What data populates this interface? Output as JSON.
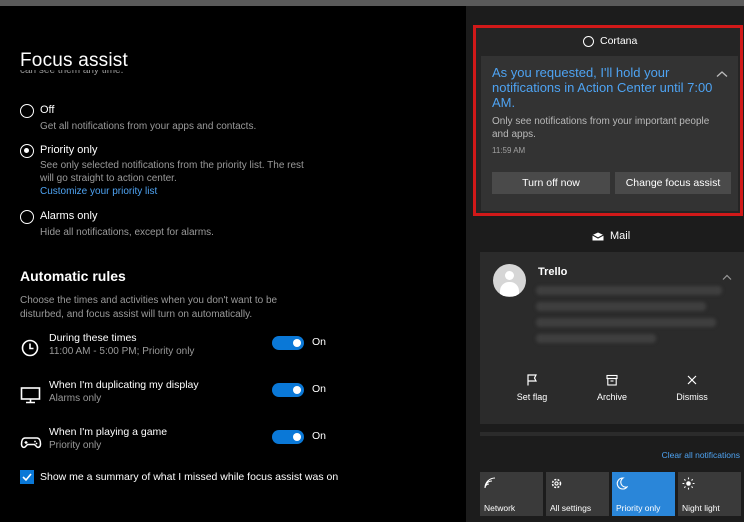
{
  "settings": {
    "title": "Focus assist",
    "clipped_text": "can see them any time.",
    "options": [
      {
        "label": "Off",
        "desc": "Get all notifications from your apps and contacts.",
        "checked": false
      },
      {
        "label": "Priority only",
        "desc_line1": "See only selected notifications from the priority list. The rest",
        "desc_line2": "will go straight to action center.",
        "link": "Customize your priority list",
        "checked": true
      },
      {
        "label": "Alarms only",
        "desc": "Hide all notifications, except for alarms.",
        "checked": false
      }
    ],
    "automatic_rules": {
      "title": "Automatic rules",
      "desc": "Choose the times and activities when you don't want to be disturbed, and focus assist will turn on automatically.",
      "rules": [
        {
          "title": "During these times",
          "subtitle": "11:00 AM - 5:00 PM; Priority only",
          "state": "On",
          "icon": "clock-icon"
        },
        {
          "title": "When I'm duplicating my display",
          "subtitle": "Alarms only",
          "state": "On",
          "icon": "monitor-icon"
        },
        {
          "title": "When I'm playing a game",
          "subtitle": "Priority only",
          "state": "On",
          "icon": "gamepad-icon"
        }
      ]
    },
    "summary_checkbox": {
      "label": "Show me a summary of what I missed while focus assist was on",
      "checked": true
    }
  },
  "action_center": {
    "cortana": {
      "title": "Cortana",
      "headline": "As you requested, I'll hold your notifications in Action Center until 7:00 AM.",
      "body": "Only see notifications from your important people and apps.",
      "time": "11:59 AM",
      "buttons": [
        "Turn off now",
        "Change focus assist"
      ]
    },
    "mail": {
      "title": "Mail",
      "sender": "Trello",
      "actions": [
        "Set flag",
        "Archive",
        "Dismiss"
      ]
    },
    "clear_all": "Clear all notifications",
    "quick_actions": [
      {
        "label": "Network",
        "icon": "network-icon",
        "active": false
      },
      {
        "label": "All settings",
        "icon": "gear-icon",
        "active": false
      },
      {
        "label": "Priority only",
        "icon": "moon-icon",
        "active": true
      },
      {
        "label": "Night light",
        "icon": "sun-icon",
        "active": false
      }
    ]
  },
  "colors": {
    "accent": "#0a78d7",
    "link": "#4ea3f2",
    "highlight_border": "#d11919"
  }
}
